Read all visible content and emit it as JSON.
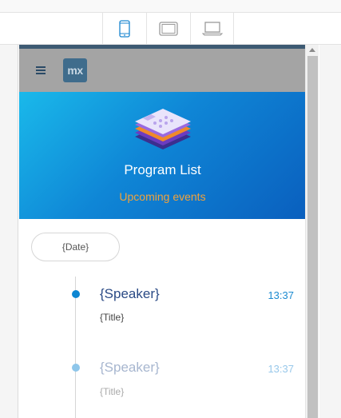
{
  "devices": {
    "phone": {
      "icon": "phone-icon",
      "active": true,
      "color": "#1a86d0"
    },
    "tablet": {
      "icon": "tablet-icon",
      "active": false,
      "color": "#9a9a9a"
    },
    "laptop": {
      "icon": "laptop-icon",
      "active": false,
      "color": "#9a9a9a"
    }
  },
  "app": {
    "logo_text": "mx",
    "menu_icon": "hamburger-menu-icon"
  },
  "hero": {
    "icon": "stacked-layers-icon",
    "title": "Program List",
    "subtitle": "Upcoming events"
  },
  "timeline": {
    "date_label": "{Date}",
    "items": [
      {
        "speaker": "{Speaker}",
        "time": "13:37",
        "title": "{Title}"
      },
      {
        "speaker": "{Speaker}",
        "time": "13:37",
        "title": "{Title}"
      }
    ]
  },
  "colors": {
    "accent": "#1a86d0",
    "hero_start": "#1ab9ea",
    "hero_end": "#0a5fbe",
    "subtitle": "#f2a23a"
  }
}
